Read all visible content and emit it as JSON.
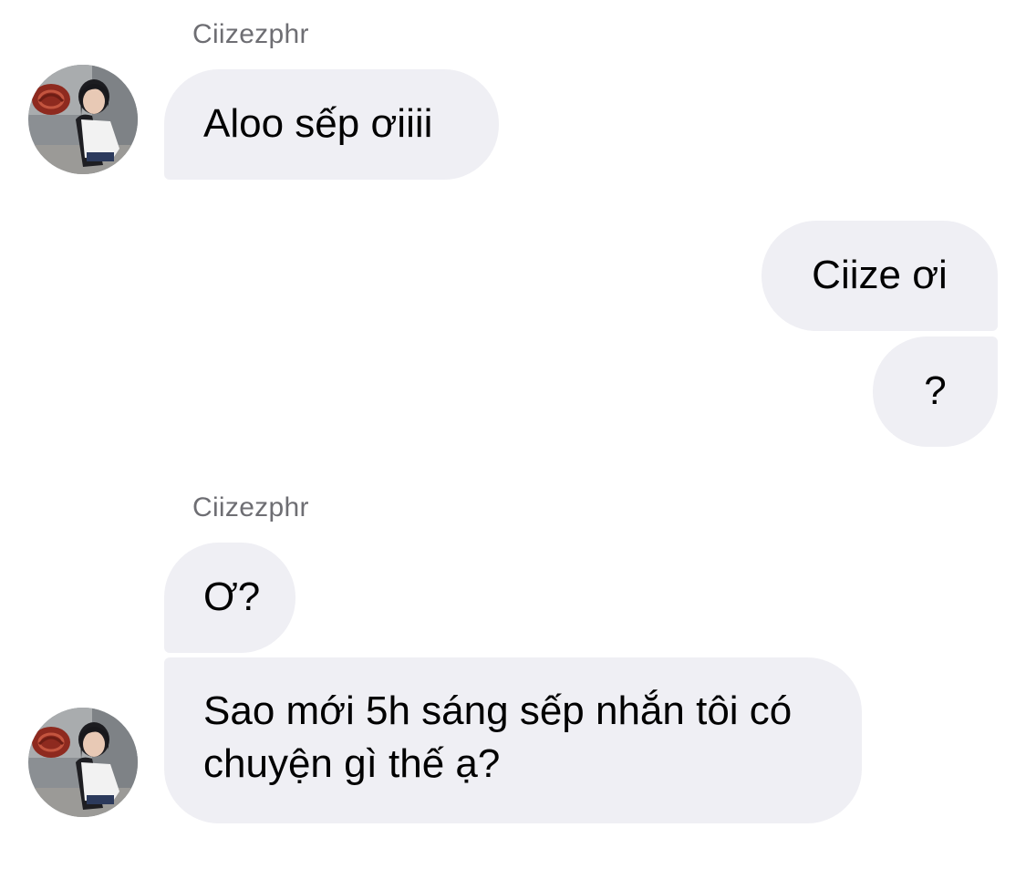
{
  "chat": {
    "groups": [
      {
        "sender": "Ciizezphr",
        "messages": [
          "Aloo sếp ơiiii"
        ]
      },
      {
        "sender": "",
        "messages": [
          "Ciize ơi",
          "?"
        ]
      },
      {
        "sender": "Ciizezphr",
        "messages": [
          "Ơ?",
          "Sao mới 5h sáng sếp nhắn tôi có chuyện gì thế ạ?"
        ]
      }
    ]
  },
  "avatar": {
    "icon": "profile-photo-icon"
  },
  "colors": {
    "bubble_background": "#efeff4",
    "sender_name": "#6e6e73",
    "text": "#000000",
    "background": "#ffffff"
  }
}
